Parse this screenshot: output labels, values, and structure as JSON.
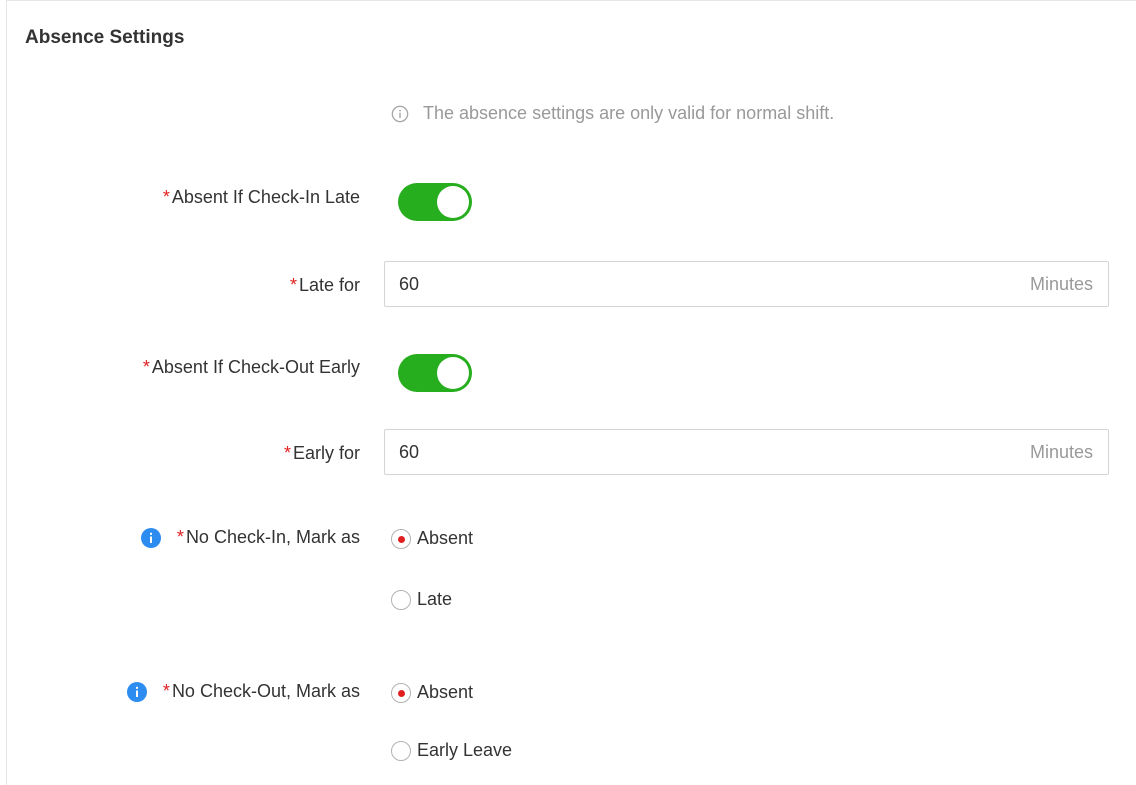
{
  "section": {
    "title": "Absence Settings"
  },
  "tip": {
    "text": "The absence settings are only valid for normal shift.",
    "icon": "info-outline-icon"
  },
  "fields": {
    "absent_if_checkin_late": {
      "label": "Absent If Check-In Late",
      "required_mark": "*",
      "enabled": true
    },
    "late_for": {
      "label": "Late for",
      "required_mark": "*",
      "value": "60",
      "suffix": "Minutes"
    },
    "absent_if_checkout_early": {
      "label": "Absent If Check-Out Early",
      "required_mark": "*",
      "enabled": true
    },
    "early_for": {
      "label": "Early for",
      "required_mark": "*",
      "value": "60",
      "suffix": "Minutes"
    },
    "no_checkin_mark_as": {
      "label": "No Check-In, Mark as",
      "required_mark": "*",
      "icon": "info-filled-icon",
      "options": [
        "Absent",
        "Late"
      ],
      "selected": "Absent"
    },
    "no_checkout_mark_as": {
      "label": "No Check-Out, Mark as",
      "required_mark": "*",
      "icon": "info-filled-icon",
      "options": [
        "Absent",
        "Early Leave"
      ],
      "selected": "Absent"
    }
  },
  "colors": {
    "toggle_on": "#27ae1e",
    "required": "#e02020",
    "info_icon": "#2d8cf0",
    "radio_dot": "#e02020"
  }
}
